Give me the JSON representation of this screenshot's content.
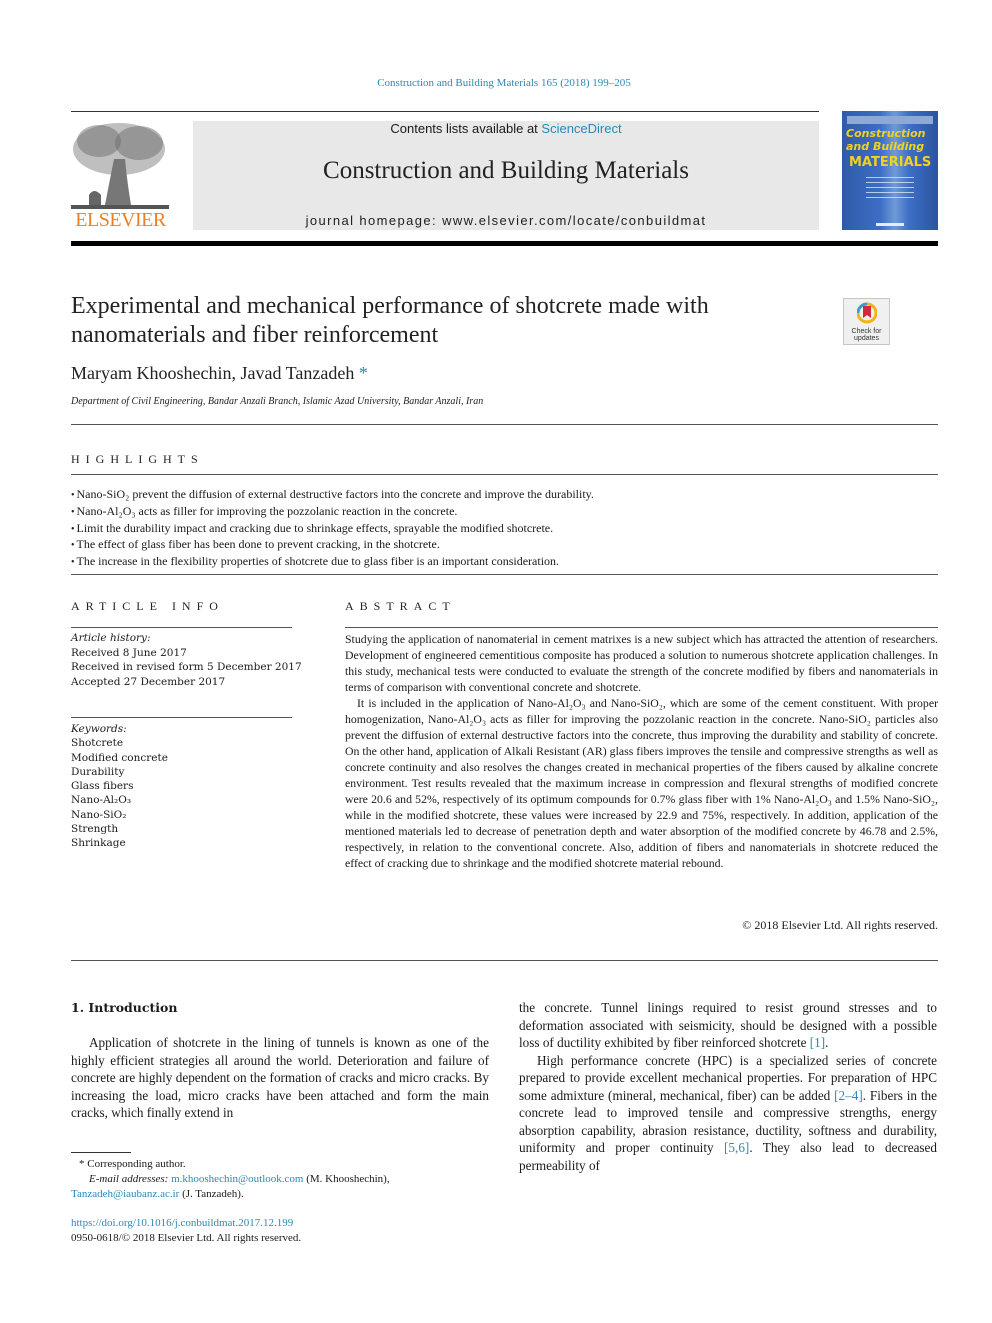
{
  "journal_ref": "Construction and Building Materials 165 (2018) 199–205",
  "masthead": {
    "contents_prefix": "Contents lists available at ",
    "contents_link": "ScienceDirect",
    "journal_title": "Construction and Building Materials",
    "homepage": "journal homepage: www.elsevier.com/locate/conbuildmat",
    "publisher_logo": "ELSEVIER",
    "cover_title": "Construction and Building",
    "cover_subtitle": "MATERIALS"
  },
  "badge": {
    "label_line1": "Check for",
    "label_line2": "updates"
  },
  "article": {
    "title": "Experimental and mechanical performance of shotcrete made with nanomaterials and fiber reinforcement",
    "authors": "Maryam Khooshechin, Javad Tanzadeh",
    "author_mark": "*",
    "affiliation": "Department of Civil Engineering, Bandar Anzali Branch, Islamic Azad University, Bandar Anzali, Iran"
  },
  "highlights": {
    "heading": "HIGHLIGHTS",
    "items": [
      "Nano-SiO₂ prevent the diffusion of external destructive factors into the concrete and improve the durability.",
      "Nano-Al₂O₃ acts as filler for improving the pozzolanic reaction in the concrete.",
      "Limit the durability impact and cracking due to shrinkage effects, sprayable the modified shotcrete.",
      "The effect of glass fiber has been done to prevent cracking, in the shotcrete.",
      "The increase in the flexibility properties of shotcrete due to glass fiber is an important consideration."
    ]
  },
  "article_info": {
    "heading": "ARTICLE INFO",
    "history_label": "Article history:",
    "history": [
      "Received 8 June 2017",
      "Received in revised form 5 December 2017",
      "Accepted 27 December 2017"
    ],
    "keywords_label": "Keywords:",
    "keywords": [
      "Shotcrete",
      "Modified concrete",
      "Durability",
      "Glass fibers",
      "Nano-Al₂O₃",
      "Nano-SiO₂",
      "Strength",
      "Shrinkage"
    ]
  },
  "abstract": {
    "heading": "ABSTRACT",
    "paragraphs": [
      "Studying the application of nanomaterial in cement matrixes is a new subject which has attracted the attention of researchers. Development of engineered cementitious composite has produced a solution to numerous shotcrete application challenges. In this study, mechanical tests were conducted to evaluate the strength of the concrete modified by fibers and nanomaterials in terms of comparison with conventional concrete and shotcrete.",
      "It is included in the application of Nano-Al₂O₃ and Nano-SiO₂, which are some of the cement constituent. With proper homogenization, Nano-Al₂O₃ acts as filler for improving the pozzolanic reaction in the concrete. Nano-SiO₂ particles also prevent the diffusion of external destructive factors into the concrete, thus improving the durability and stability of concrete. On the other hand, application of Alkali Resistant (AR) glass fibers improves the tensile and compressive strengths as well as concrete continuity and also resolves the changes created in mechanical properties of the fibers caused by alkaline concrete environment. Test results revealed that the maximum increase in compression and flexural strengths of modified concrete were 20.6 and 52%, respectively of its optimum compounds for 0.7% glass fiber with 1% Nano-Al₂O₃ and 1.5% Nano-SiO₂, while in the modified shotcrete, these values were increased by 22.9 and 75%, respectively. In addition, application of the mentioned materials led to decrease of penetration depth and water absorption of the modified concrete by 46.78 and 2.5%, respectively, in relation to the conventional concrete. Also, addition of fibers and nanomaterials in shotcrete reduced the effect of cracking due to shrinkage and the modified shotcrete material rebound."
    ],
    "copyright": "© 2018 Elsevier Ltd. All rights reserved."
  },
  "introduction": {
    "heading": "1. Introduction",
    "left_paragraph": "Application of shotcrete in the lining of tunnels is known as one of the highly efficient strategies all around the world. Deterioration and failure of concrete are highly dependent on the formation of cracks and micro cracks. By increasing the load, micro cracks have been attached and form the main cracks, which finally extend in",
    "right_p1_text": "the concrete. Tunnel linings required to resist ground stresses and to deformation associated with seismicity, should be designed with a possible loss of ductility exhibited by fiber reinforced shotcrete ",
    "right_p1_ref": "[1]",
    "right_p1_end": ".",
    "right_p2_a": "High performance concrete (HPC) is a specialized series of concrete prepared to provide excellent mechanical properties. For preparation of HPC some admixture (mineral, mechanical, fiber) can be added ",
    "right_p2_ref1": "[2–4]",
    "right_p2_b": ". Fibers in the concrete lead to improved tensile and compressive strengths, energy absorption capability, abrasion resistance, ductility, softness and durability, uniformity and proper continuity ",
    "right_p2_ref2": "[5,6]",
    "right_p2_c": ". They also lead to decreased permeability of"
  },
  "footnote": {
    "corresponding": "* Corresponding author.",
    "email_label": "E-mail addresses: ",
    "email1": "m.khooshechin@outlook.com",
    "email1_owner": " (M. Khooshechin), ",
    "email2": "Tanzadeh@iaubanz.ac.ir",
    "email2_owner": " (J. Tanzadeh)."
  },
  "doi": {
    "url": "https://doi.org/10.1016/j.conbuildmat.2017.12.199",
    "issn_line": "0950-0618/© 2018 Elsevier Ltd. All rights reserved."
  },
  "colors": {
    "link": "#2a8ab5",
    "elsevier_orange": "#f07e1e",
    "cover_blue": "#3d6ec4",
    "cover_yellow": "#f2d21b",
    "masthead_gray": "#e8e8e8"
  }
}
